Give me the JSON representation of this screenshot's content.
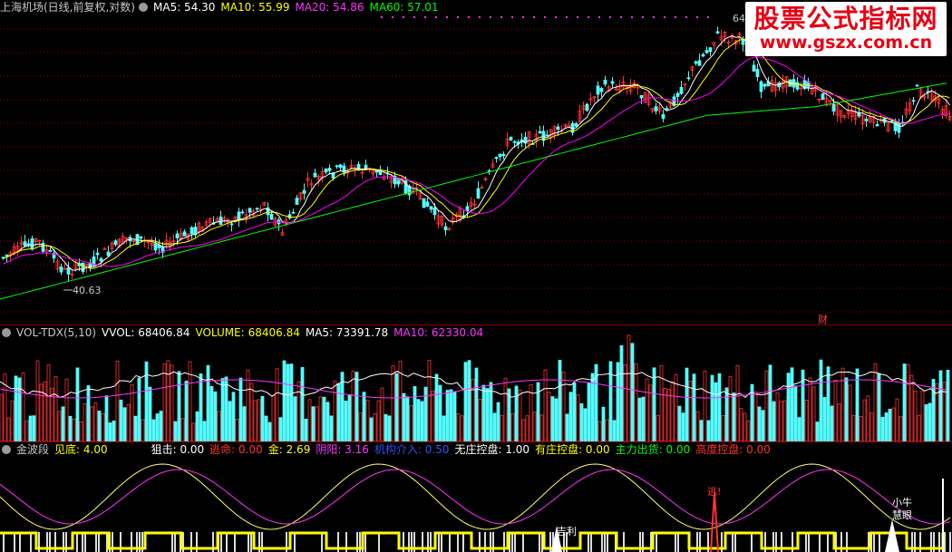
{
  "price": {
    "stock_name": "上海机场(日线,前复权,对数)",
    "ma5_label": "MA5: 54.30",
    "ma10_label": "MA10: 55.99",
    "ma20_label": "MA20: 54.86",
    "ma60_label": "MA60: 57.01",
    "high_mark": "64",
    "low_mark": "40.63",
    "cai_badge": "财"
  },
  "volume": {
    "indicator": "VOL-TDX(5,10)",
    "vvol": "VVOL: 68406.84",
    "volume": "VOLUME: 68406.84",
    "ma5": "MA5: 73391.78",
    "ma10": "MA10: 62330.04"
  },
  "indicator": {
    "name": "金波段",
    "jiandi": "见底: 4.00",
    "juji": "狙击: 0.00",
    "taoming": "逃命: 0.00",
    "jin": "金: 2.69",
    "yinyang": "阴阳: 3.16",
    "jigou": "机构介入: 0.50",
    "wuzhuang": "无庄控盘: 1.00",
    "youzhuang": "有庄控盘: 0.00",
    "zhuli": "主力出货: 0.00",
    "gaodu": "高度控盘: 0.00",
    "tao_label": "逃!",
    "xiaoniu_label": "小牛",
    "huiyan_label": "慧眼",
    "xili_label": "吉利"
  },
  "watermark": {
    "title": "股票公式指标网",
    "url": "www.gszx.com.cn"
  },
  "colors": {
    "up": "#ff3232",
    "down": "#54fcfc",
    "ma5": "#ffffff",
    "ma10": "#ffff00",
    "ma20": "#ff00ff",
    "ma60": "#00ff00",
    "grid": "#8b0000",
    "wave1": "#ffff66",
    "wave2": "#ff33ff"
  }
}
